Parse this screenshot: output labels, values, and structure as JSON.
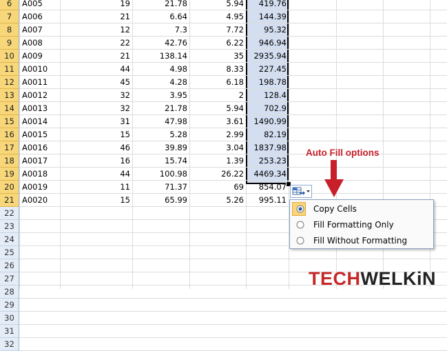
{
  "rows": [
    {
      "num": "6",
      "id": "A005",
      "a": "19",
      "b": "21.78",
      "c": "5.94",
      "d": "419.76"
    },
    {
      "num": "7",
      "id": "A006",
      "a": "21",
      "b": "6.64",
      "c": "4.95",
      "d": "144.39"
    },
    {
      "num": "8",
      "id": "A007",
      "a": "12",
      "b": "7.3",
      "c": "7.72",
      "d": "95.32"
    },
    {
      "num": "9",
      "id": "A008",
      "a": "22",
      "b": "42.76",
      "c": "6.22",
      "d": "946.94"
    },
    {
      "num": "10",
      "id": "A009",
      "a": "21",
      "b": "138.14",
      "c": "35",
      "d": "2935.94"
    },
    {
      "num": "11",
      "id": "A0010",
      "a": "44",
      "b": "4.98",
      "c": "8.33",
      "d": "227.45"
    },
    {
      "num": "12",
      "id": "A0011",
      "a": "45",
      "b": "4.28",
      "c": "6.18",
      "d": "198.78"
    },
    {
      "num": "13",
      "id": "A0012",
      "a": "32",
      "b": "3.95",
      "c": "2",
      "d": "128.4"
    },
    {
      "num": "14",
      "id": "A0013",
      "a": "32",
      "b": "21.78",
      "c": "5.94",
      "d": "702.9"
    },
    {
      "num": "15",
      "id": "A0014",
      "a": "31",
      "b": "47.98",
      "c": "3.61",
      "d": "1490.99"
    },
    {
      "num": "16",
      "id": "A0015",
      "a": "15",
      "b": "5.28",
      "c": "2.99",
      "d": "82.19"
    },
    {
      "num": "17",
      "id": "A0016",
      "a": "46",
      "b": "39.89",
      "c": "3.04",
      "d": "1837.98"
    },
    {
      "num": "18",
      "id": "A0017",
      "a": "16",
      "b": "15.74",
      "c": "1.39",
      "d": "253.23"
    },
    {
      "num": "19",
      "id": "A0018",
      "a": "44",
      "b": "100.98",
      "c": "26.22",
      "d": "4469.34"
    },
    {
      "num": "20",
      "id": "A0019",
      "a": "11",
      "b": "71.37",
      "c": "69",
      "d": "854.07"
    },
    {
      "num": "21",
      "id": "A0020",
      "a": "15",
      "b": "65.99",
      "c": "5.26",
      "d": "995.11"
    }
  ],
  "empty_rows": [
    "22",
    "23",
    "24",
    "25",
    "26",
    "27",
    "28",
    "29",
    "30",
    "31",
    "32"
  ],
  "autofill_menu": {
    "items": [
      {
        "label": "Copy Cells",
        "selected": true
      },
      {
        "label": "Fill Formatting Only",
        "selected": false
      },
      {
        "label": "Fill Without Formatting",
        "selected": false
      }
    ]
  },
  "callout_label": "Auto Fill options",
  "logo": {
    "part1": "TECH",
    "part2": "WELKiN"
  },
  "colors": {
    "callout": "#c8202a",
    "selection": "#d3def0",
    "header_selected": "#f8d77a"
  }
}
